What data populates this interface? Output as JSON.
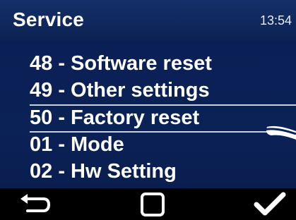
{
  "header": {
    "title": "Service",
    "time": "13:54"
  },
  "menu": {
    "items": [
      {
        "label": "48 - Software reset"
      },
      {
        "label": "49 - Other settings"
      },
      {
        "label": "50 - Factory reset"
      },
      {
        "label": "01 - Mode"
      },
      {
        "label": "02 - Hw Setting"
      }
    ],
    "selected_index": 2
  },
  "bottom_bar": {
    "left_icon": "back-arrow-icon",
    "center_icon": "square-icon",
    "right_icon": "checkmark-icon"
  },
  "colors": {
    "header_bg": "#14306a",
    "body_bg": "#0b2257",
    "text": "#ffffff",
    "bottom_bg": "#000000"
  }
}
